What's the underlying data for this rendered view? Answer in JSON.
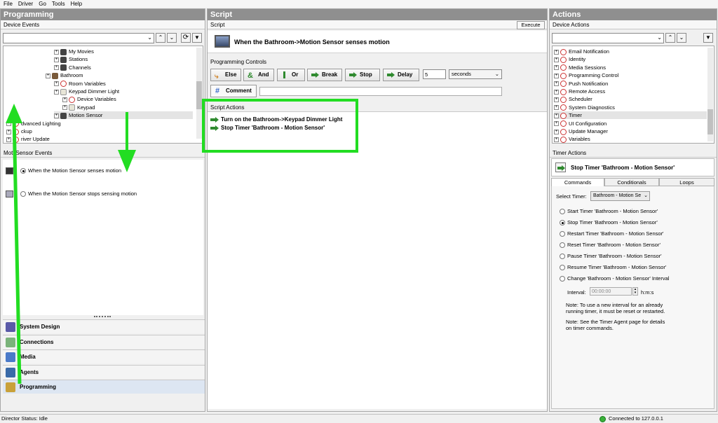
{
  "menu": [
    "File",
    "Driver",
    "Go",
    "Tools",
    "Help"
  ],
  "left": {
    "title": "Programming",
    "device_events_label": "Device Events",
    "tree": [
      {
        "label": "My Movies",
        "indent": 2,
        "icon": "dev"
      },
      {
        "label": "Stations",
        "indent": 2,
        "icon": "dev"
      },
      {
        "label": "Channels",
        "indent": 2,
        "icon": "dev"
      },
      {
        "label": "Bathroom",
        "indent": 1,
        "icon": "room"
      },
      {
        "label": "Room Variables",
        "indent": 2,
        "icon": "var"
      },
      {
        "label": "Keypad Dimmer Light",
        "indent": 2,
        "icon": "kp"
      },
      {
        "label": "Device Variables",
        "indent": 3,
        "icon": "var"
      },
      {
        "label": "Keypad",
        "indent": 3,
        "icon": "kp"
      },
      {
        "label": "Motion Sensor",
        "indent": 2,
        "icon": "dev",
        "selected": true
      },
      {
        "label": "dvanced Lighting",
        "indent": 0,
        "icon": "red"
      },
      {
        "label": "ckup",
        "indent": 0,
        "icon": "red"
      },
      {
        "label": "river Update",
        "indent": 0,
        "icon": "red"
      }
    ],
    "events_label": "Moti  Sensor Events",
    "events": [
      {
        "label": "When the Motion Sensor senses motion",
        "selected": true
      },
      {
        "label": "When the Motion Sensor stops sensing motion",
        "selected": false
      }
    ],
    "nav": [
      {
        "label": "System Design",
        "icon": "system-design-icon",
        "color": "#5a5aa8"
      },
      {
        "label": "Connections",
        "icon": "connections-icon",
        "color": "#7ab37a"
      },
      {
        "label": "Media",
        "icon": "media-icon",
        "color": "#4a7ac9"
      },
      {
        "label": "Agents",
        "icon": "agents-icon",
        "color": "#3a6aa8"
      },
      {
        "label": "Programming",
        "icon": "programming-icon",
        "color": "#c9a13a",
        "active": true
      }
    ]
  },
  "script": {
    "title": "Script",
    "sub_label": "Script",
    "execute_label": "Execute",
    "header_text": "When the Bathroom->Motion Sensor senses motion",
    "controls_label": "Programming Controls",
    "buttons": [
      "Else",
      "And",
      "Or",
      "Break",
      "Stop",
      "Delay"
    ],
    "delay_value": "5",
    "delay_unit": "seconds",
    "comment_label": "Comment",
    "actions_label": "Script Actions",
    "actions": [
      "Turn on the Bathroom->Keypad Dimmer Light",
      "Stop Timer 'Bathroom - Motion Sensor'"
    ]
  },
  "actions_panel": {
    "title": "Actions",
    "device_actions_label": "Device Actions",
    "tree": [
      "Email Notification",
      "Identity",
      "Media Sessions",
      "Programming Control",
      "Push Notification",
      "Remote Access",
      "Scheduler",
      "System Diagnostics",
      "Timer",
      "UI Configuration",
      "Update Manager",
      "Variables"
    ],
    "selected_item": "Timer",
    "timer_actions_label": "Timer Actions",
    "timer_header": "Stop Timer 'Bathroom - Motion Sensor'",
    "tabs": [
      "Commands",
      "Conditionals",
      "Loops"
    ],
    "select_timer_label": "Select Timer:",
    "select_timer_value": "Bathroom - Motion Se",
    "options": [
      {
        "label": "Start Timer 'Bathroom - Motion Sensor'",
        "selected": false
      },
      {
        "label": "Stop Timer 'Bathroom - Motion Sensor'",
        "selected": true
      },
      {
        "label": "Restart Timer 'Bathroom - Motion Sensor'",
        "selected": false
      },
      {
        "label": "Reset Timer 'Bathroom - Motion Sensor'",
        "selected": false
      },
      {
        "label": "Pause Timer 'Bathroom - Motion Sensor'",
        "selected": false
      },
      {
        "label": "Resume Timer 'Bathroom - Motion Sensor'",
        "selected": false
      },
      {
        "label": "Change 'Bathroom - Motion Sensor' Interval",
        "selected": false
      }
    ],
    "interval_label": "Interval:",
    "interval_value": "00:00:00",
    "interval_unit": "h:m:s",
    "note1": "Note: To use a new interval for an already running timer, it must be reset or restarted.",
    "note2": "Note: See the Timer Agent page for details on timer commands."
  },
  "status": {
    "left": "Director Status: Idle",
    "right": "Connected to 127.0.0.1",
    "connected_color": "#3ab03a"
  },
  "annotation_color": "#22dd22"
}
